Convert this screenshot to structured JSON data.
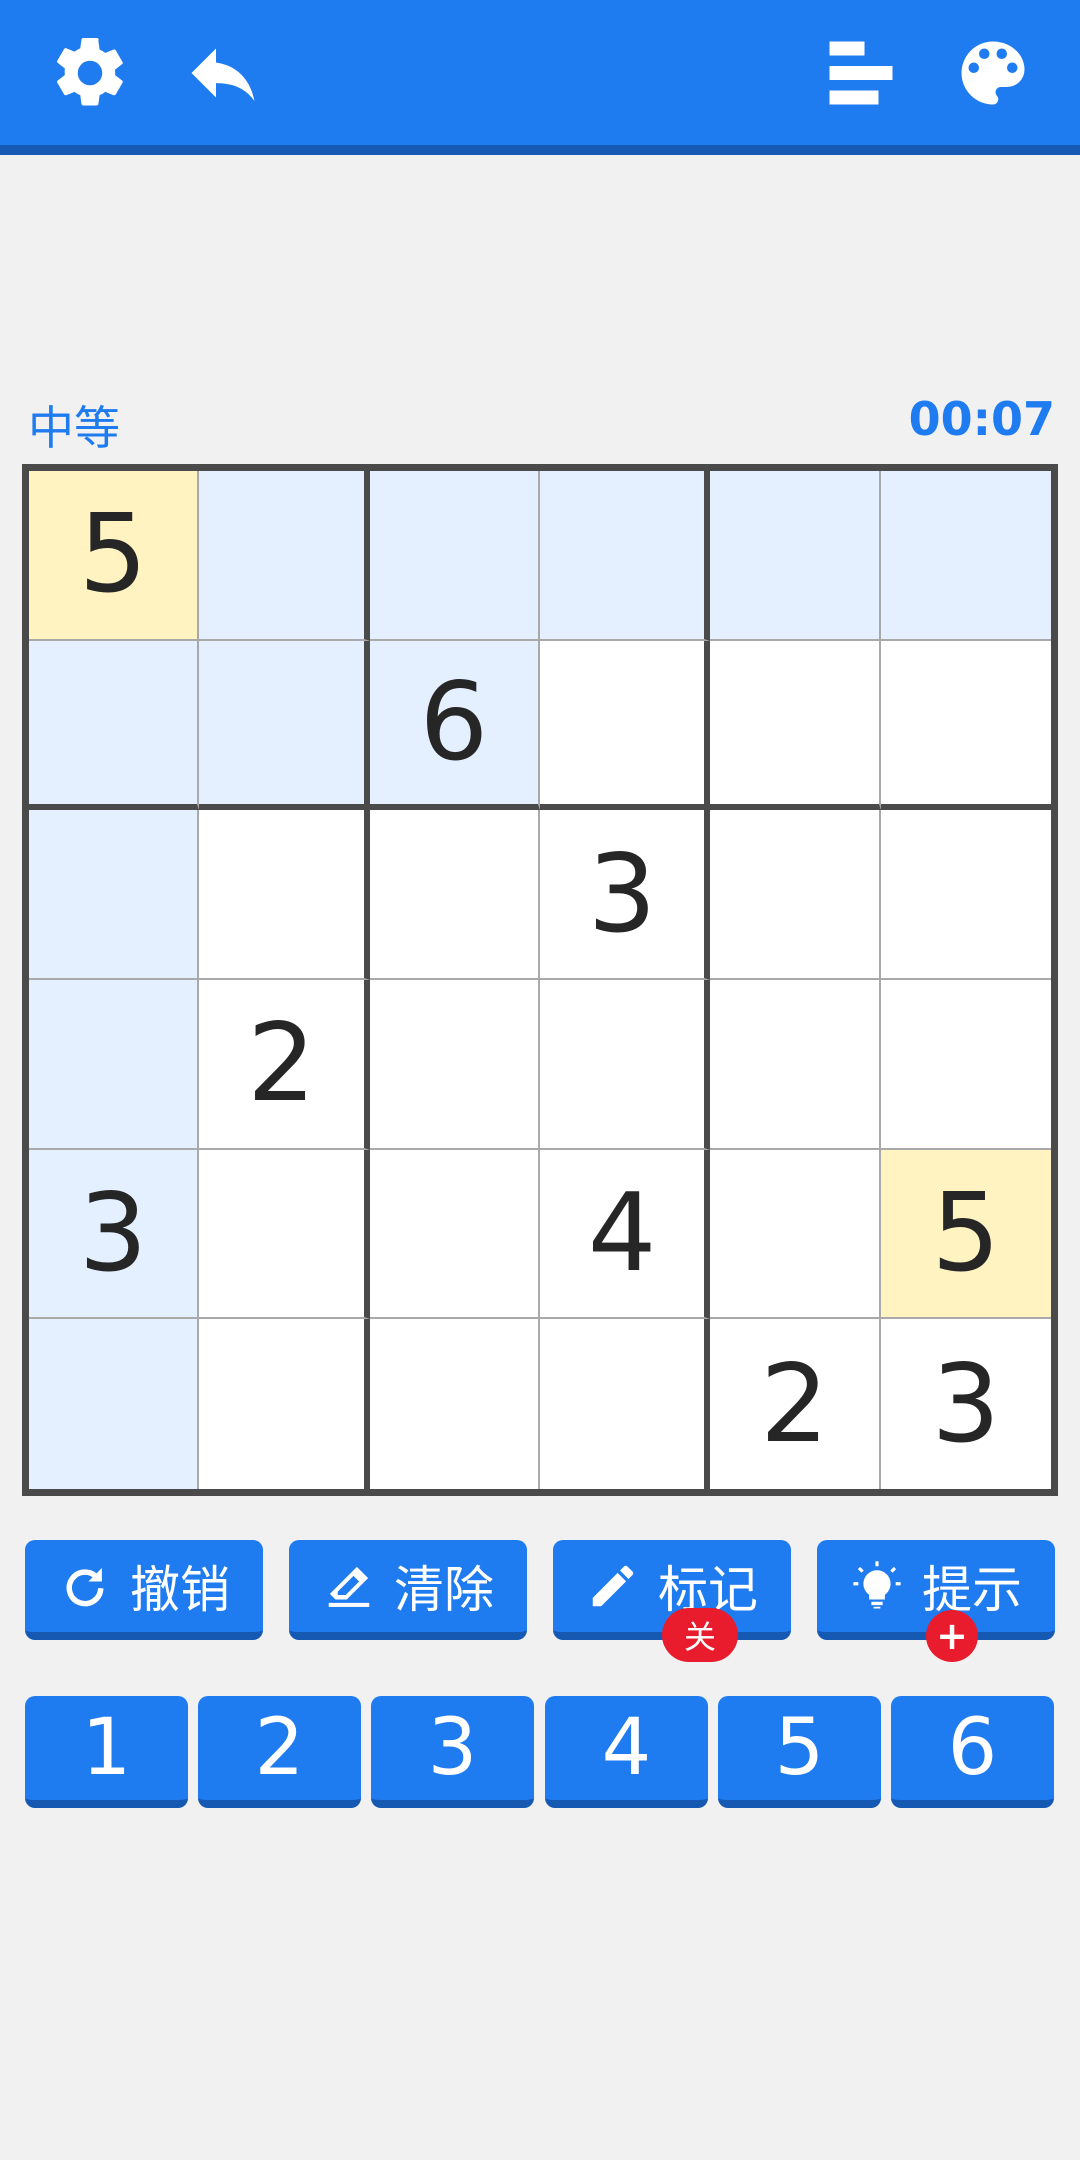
{
  "toolbar": {
    "icons": [
      "gear-icon",
      "undo-arrow-icon",
      "stats-icon",
      "palette-icon"
    ]
  },
  "game": {
    "difficulty": "中等",
    "timer": "00:07"
  },
  "board": {
    "size": 6,
    "cells": [
      [
        "5",
        "",
        "",
        "",
        "",
        ""
      ],
      [
        "",
        "",
        "6",
        "",
        "",
        ""
      ],
      [
        "",
        "",
        "",
        "3",
        "",
        ""
      ],
      [
        "",
        "2",
        "",
        "",
        "",
        ""
      ],
      [
        "3",
        "",
        "",
        "4",
        "",
        "5"
      ],
      [
        "",
        "",
        "",
        "",
        "2",
        "3"
      ]
    ],
    "selected": [
      0,
      0
    ],
    "same_value_highlight": [
      [
        4,
        5
      ]
    ],
    "highlight_color": "#e4f0ff",
    "selected_color": "#fff4c1"
  },
  "actions": {
    "undo": "撤销",
    "erase": "清除",
    "notes": "标记",
    "notes_badge": "关",
    "hint": "提示",
    "hint_badge": "+"
  },
  "numpad": [
    "1",
    "2",
    "3",
    "4",
    "5",
    "6"
  ],
  "colors": {
    "accent": "#1f7bf0",
    "accent_dark": "#1559b3",
    "badge_red": "#e81c2d"
  }
}
